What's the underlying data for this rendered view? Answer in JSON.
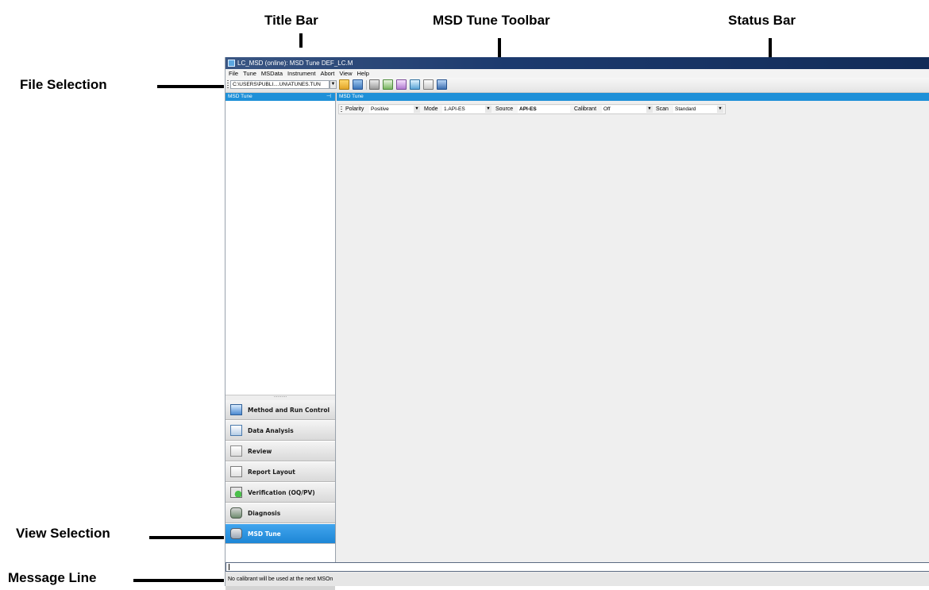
{
  "callouts": {
    "title_bar": "Title Bar",
    "msd_tune_toolbar": "MSD Tune Toolbar",
    "status_bar": "Status Bar",
    "file_selection": "File Selection",
    "view_selection": "View Selection",
    "message_line": "Message Line"
  },
  "window": {
    "title": "LC_MSD (online): MSD Tune DEF_LC.M"
  },
  "menu": [
    "File",
    "Tune",
    "MSData",
    "Instrument",
    "Abort",
    "View",
    "Help"
  ],
  "toolbar": {
    "file_path": "C:\\USERS\\PUBLI....UN\\ATUNES.TUN"
  },
  "left_panel": {
    "header": "MSD Tune",
    "pin_icon": "pin-icon",
    "splitter_dots": "..........",
    "nav_items": [
      {
        "label": "Method and Run Control",
        "icon": "method-run-control-icon"
      },
      {
        "label": "Data Analysis",
        "icon": "data-analysis-icon"
      },
      {
        "label": "Review",
        "icon": "review-icon"
      },
      {
        "label": "Report Layout",
        "icon": "report-layout-icon"
      },
      {
        "label": "Verification (OQ/PV)",
        "icon": "verification-icon"
      },
      {
        "label": "Diagnosis",
        "icon": "diagnosis-icon"
      },
      {
        "label": "MSD Tune",
        "icon": "msd-tune-icon",
        "active": true
      }
    ],
    "more_glyph": "»"
  },
  "content": {
    "header": "MSD Tune",
    "status_bar": {
      "polarity_label": "Polarity",
      "polarity_value": "Positive",
      "mode_label": "Mode",
      "mode_value": "1.API-ES",
      "source_label": "Source",
      "source_value": "API-ES",
      "calibrant_label": "Calibrant",
      "calibrant_value": "Off",
      "scan_label": "Scan",
      "scan_value": "Standard"
    }
  },
  "message_line": {
    "input_value": "",
    "text": "No calibrant will be used at the next MSOn"
  },
  "colors": {
    "title_bar": "#1c3a6e",
    "panel_header": "#1e90d8",
    "active_nav": "#1d86d6"
  }
}
